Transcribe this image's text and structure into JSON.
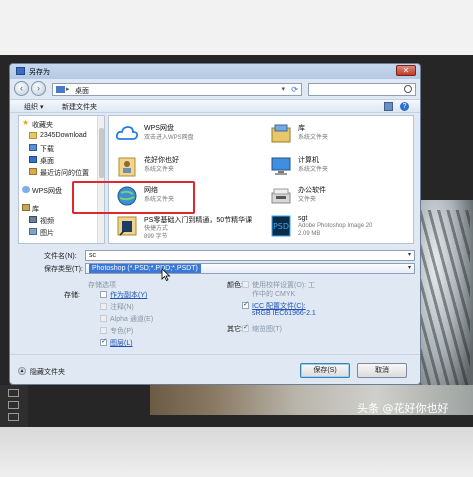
{
  "dialog": {
    "title": "另存为",
    "close_label": "✕"
  },
  "nav": {
    "address": "桌面",
    "address_caret": "▸",
    "search_placeholder": ""
  },
  "toolbar": {
    "organize": "组织 ▾",
    "new_folder": "新建文件夹"
  },
  "sidebar": {
    "items": [
      {
        "label": "收藏夹",
        "icon": "star-icon"
      },
      {
        "label": "2345Download",
        "icon": "folder-icon"
      },
      {
        "label": "下载",
        "icon": "download-folder-icon"
      },
      {
        "label": "桌面",
        "icon": "desktop-icon"
      },
      {
        "label": "最近访问的位置",
        "icon": "recent-places-icon"
      },
      {
        "label": "WPS网盘",
        "icon": "cloud-icon"
      },
      {
        "label": "库",
        "icon": "library-icon"
      },
      {
        "label": "视频",
        "icon": "video-icon"
      },
      {
        "label": "图片",
        "icon": "pictures-icon"
      }
    ]
  },
  "files": [
    {
      "name": "WPS网盘",
      "sub": "双击进入WPS网盘",
      "sub2": "",
      "icon": "cloud-icon"
    },
    {
      "name": "库",
      "sub": "系统文件夹",
      "sub2": "",
      "icon": "library-icon"
    },
    {
      "name": "花好你也好",
      "sub": "系统文件夹",
      "sub2": "",
      "icon": "user-folder-icon"
    },
    {
      "name": "计算机",
      "sub": "系统文件夹",
      "sub2": "",
      "icon": "computer-icon"
    },
    {
      "name": "网络",
      "sub": "系统文件夹",
      "sub2": "",
      "icon": "network-icon"
    },
    {
      "name": "办公软件",
      "sub": "文件夹",
      "sub2": "",
      "icon": "folder-icon"
    },
    {
      "name": "PS零基础入门到精通，50节精华课",
      "sub": "快捷方式",
      "sub2": "899 字节",
      "icon": "ps-shortcut-icon"
    },
    {
      "name": "sgt",
      "sub": "Adobe Photoshop Image 20",
      "sub2": "2.09 MB",
      "icon": "psd-file-icon"
    }
  ],
  "form": {
    "filename_label": "文件名(N):",
    "filename_value": "sc",
    "filetype_label": "保存类型(T):",
    "filetype_value": "Photoshop (*.PSD;*.PDD;*.PSDT)",
    "save_options_label": "存储选项",
    "store_label": "存储:",
    "as_copy": "作为副本(Y)",
    "notes": "注释(N)",
    "alpha": "Alpha 通道(E)",
    "spot": "专色(P)",
    "layers": "图层(L)",
    "color_label": "颜色:",
    "use_proof": "使用校样设置(O):  工",
    "use_proof_2": "作中的 CMYK",
    "icc": "ICC 配置文件(C):",
    "icc_2": "sRGB IEC61966-2.1",
    "other_label": "其它:",
    "thumbnail": "缩览图(T)"
  },
  "buttons": {
    "hide_folders": "隐藏文件夹",
    "save": "保存(S)",
    "cancel": "取消"
  },
  "watermark": "头条 @花好你也好",
  "colors": {
    "accent": "#3a77d6",
    "highlight_box": "#e0262e",
    "dialog_bg": "#dfe8f3"
  }
}
